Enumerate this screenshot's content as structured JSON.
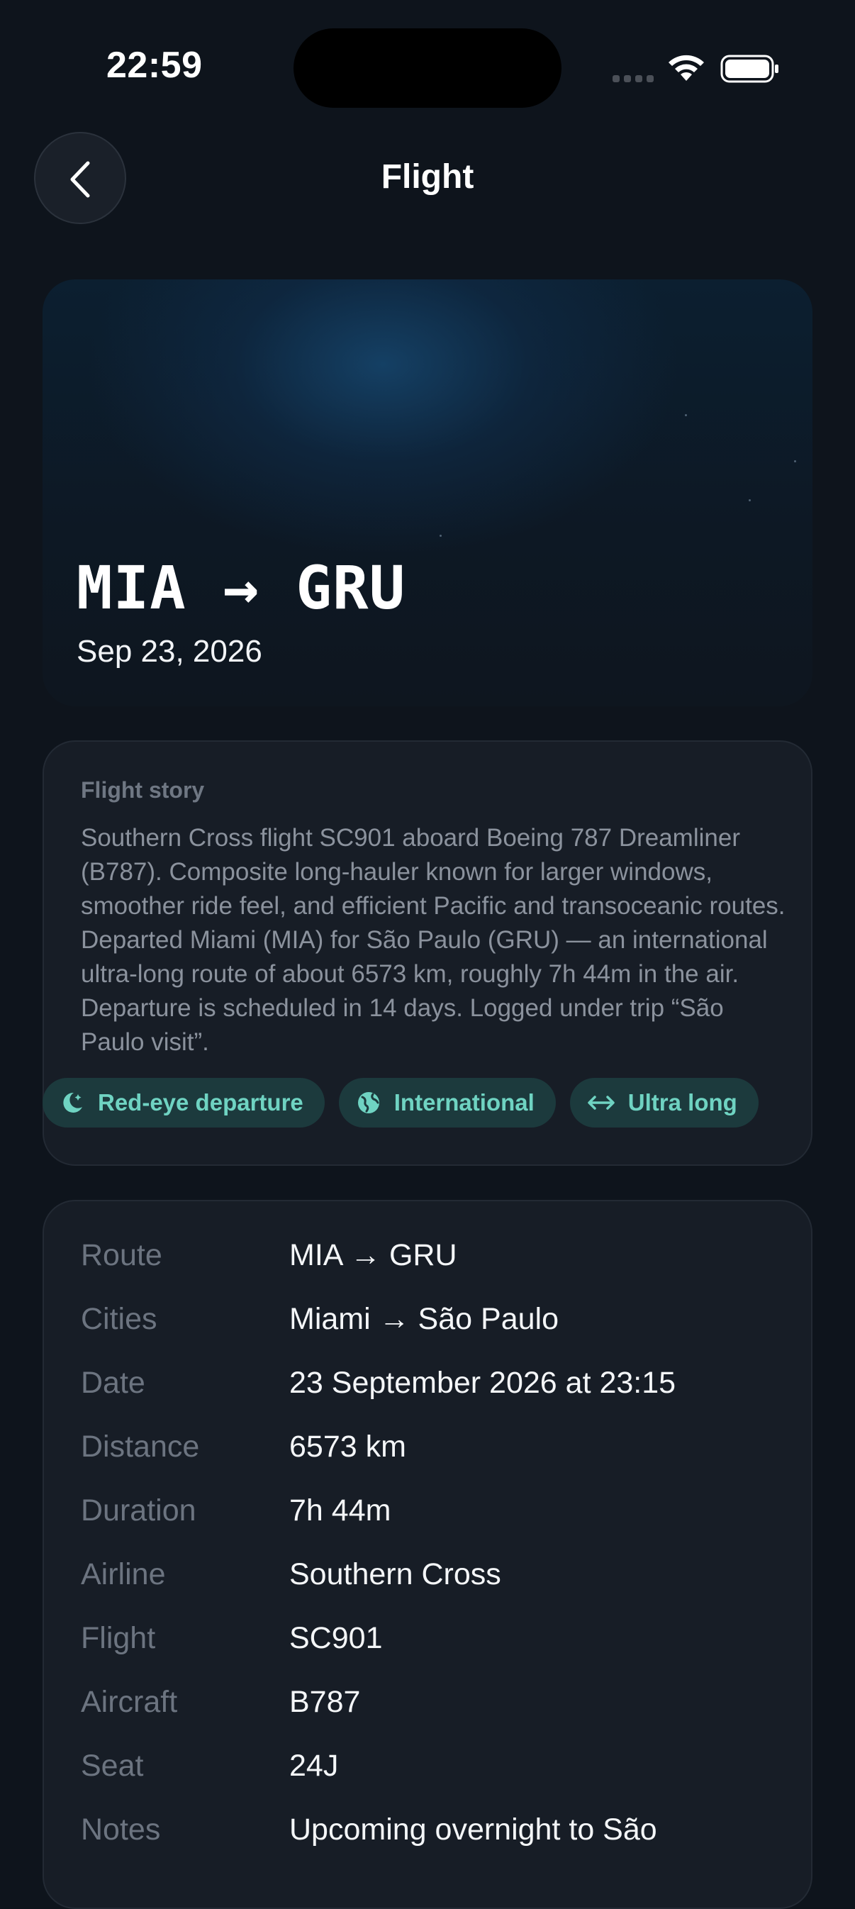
{
  "status_bar": {
    "time": "22:59"
  },
  "nav": {
    "title": "Flight",
    "back_icon": "chevron-left-icon"
  },
  "hero": {
    "route": "MIA → GRU",
    "date": "Sep 23, 2026"
  },
  "story": {
    "heading": "Flight story",
    "text": "Southern Cross flight SC901 aboard Boeing 787 Dreamliner (B787). Composite long-hauler known for larger windows, smoother ride feel, and efficient Pacific and transoceanic routes. Departed Miami (MIA) for São Paulo (GRU) — an international ultra-long route of about 6573 km, roughly 7h 44m in the air. Departure is scheduled in 14 days. Logged under trip “São Paulo visit”.",
    "tags": [
      {
        "label": "Red-eye departure",
        "icon": "moon-icon"
      },
      {
        "label": "International",
        "icon": "globe-icon"
      },
      {
        "label": "Ultra long",
        "icon": "arrows-horizontal-icon"
      }
    ]
  },
  "details": {
    "rows": [
      {
        "label": "Route",
        "value": "MIA → GRU"
      },
      {
        "label": "Cities",
        "value": "Miami → São Paulo"
      },
      {
        "label": "Date",
        "value": "23 September 2026 at 23:15"
      },
      {
        "label": "Distance",
        "value": "6573 km"
      },
      {
        "label": "Duration",
        "value": "7h 44m"
      },
      {
        "label": "Airline",
        "value": "Southern Cross"
      },
      {
        "label": "Flight",
        "value": "SC901"
      },
      {
        "label": "Aircraft",
        "value": "B787"
      },
      {
        "label": "Seat",
        "value": "24J"
      },
      {
        "label": "Notes",
        "value": "Upcoming overnight to São"
      }
    ]
  },
  "colors": {
    "background": "#0e141c",
    "card": "#171d26",
    "accent": "#6fd3c2",
    "tag_background": "#1c3a3d"
  }
}
